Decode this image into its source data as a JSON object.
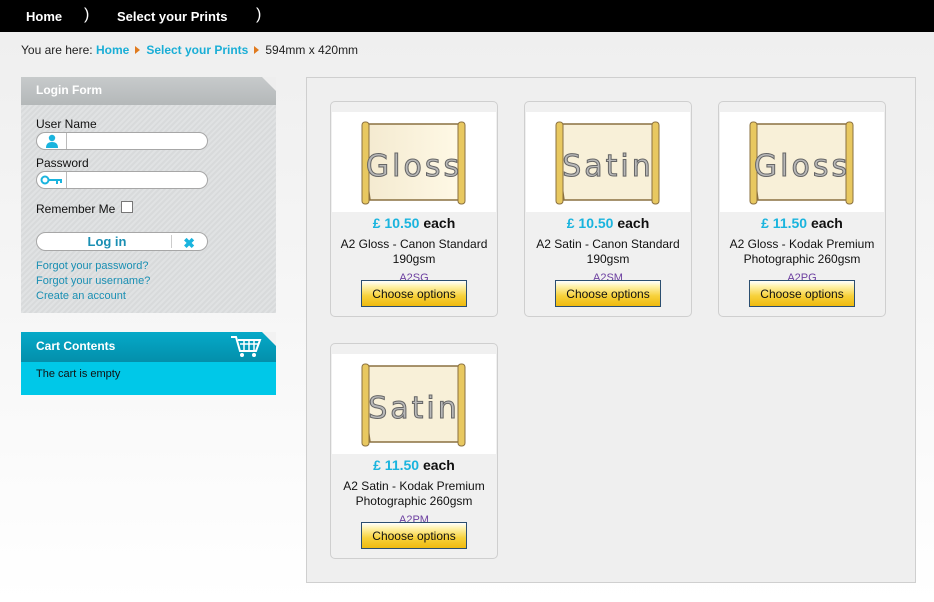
{
  "topnav": {
    "items": [
      {
        "label": "Home"
      },
      {
        "label": "Select your Prints"
      }
    ],
    "separator": ")"
  },
  "breadcrumb": {
    "prefix": "You are here:",
    "links": [
      "Home",
      "Select your Prints"
    ],
    "current": "594mm x 420mm"
  },
  "login": {
    "title": "Login Form",
    "username_label": "User Name",
    "username_value": "",
    "password_label": "Password",
    "password_value": "",
    "remember_label": "Remember Me",
    "remember_checked": false,
    "login_button": "Log in",
    "links": [
      "Forgot your password?",
      "Forgot your username?",
      "Create an account"
    ]
  },
  "cart": {
    "title": "Cart Contents",
    "status": "The cart is empty"
  },
  "products": [
    {
      "finish": "Gloss",
      "price": "£ 10.50",
      "each": "each",
      "name": "A2 Gloss - Canon Standard 190gsm",
      "sku": "A2SG",
      "button": "Choose options"
    },
    {
      "finish": "Satin",
      "price": "£ 10.50",
      "each": "each",
      "name": "A2 Satin - Canon Standard 190gsm",
      "sku": "A2SM",
      "button": "Choose options"
    },
    {
      "finish": "Gloss",
      "price": "£ 11.50",
      "each": "each",
      "name": "A2 Gloss - Kodak Premium Photographic 260gsm",
      "sku": "A2PG",
      "button": "Choose options"
    },
    {
      "finish": "Satin",
      "price": "£ 11.50",
      "each": "each",
      "name": "A2 Satin - Kodak Premium Photographic 260gsm",
      "sku": "A2PM",
      "button": "Choose options"
    }
  ],
  "colors": {
    "accent": "#1ab4de",
    "cart": "#00c8e8",
    "button": "#f7d13a"
  }
}
